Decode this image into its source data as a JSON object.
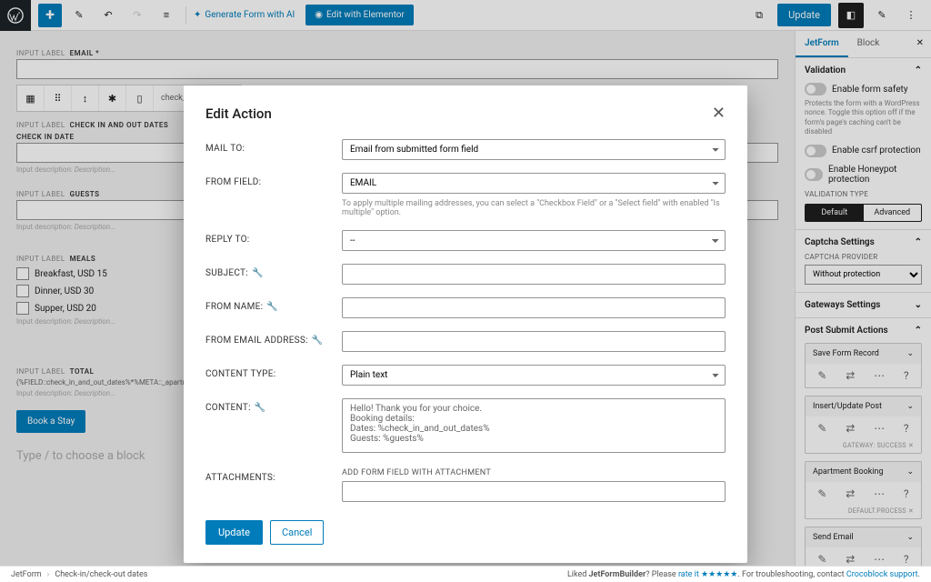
{
  "topbar": {
    "gen_ai": "Generate Form with AI",
    "elementor": "Edit with Elementor",
    "update": "Update"
  },
  "canvas": {
    "email": {
      "prefix": "INPUT LABEL",
      "label": "EMAIL *"
    },
    "toolbar_caption": "check_in_and_out_d",
    "checkin": {
      "prefix": "INPUT LABEL",
      "label": "CHECK IN AND OUT DATES",
      "sublabel": "CHECK IN DATE"
    },
    "desc_prefix": "Input description:",
    "desc_placeholder": "Description...",
    "guests": {
      "prefix": "INPUT LABEL",
      "label": "GUESTS"
    },
    "meals": {
      "prefix": "INPUT LABEL",
      "label": "MEALS",
      "options": [
        "Breakfast, USD 15",
        "Dinner, USD 30",
        "Supper, USD 20"
      ]
    },
    "total": {
      "prefix": "INPUT LABEL",
      "label": "TOTAL",
      "formula": "(%FIELD::check_in_and_out_dates%*%META::_apartment_pr"
    },
    "submit": "Book a Stay",
    "placeholder": "Type / to choose a block"
  },
  "sidebar": {
    "tabs": {
      "jetform": "JetForm",
      "block": "Block"
    },
    "validation": {
      "title": "Validation",
      "safety": "Enable form safety",
      "safety_desc": "Protects the form with a WordPress nonce. Toggle this option off if the form's page's caching can't be disabled",
      "csrf": "Enable csrf protection",
      "honeypot": "Enable Honeypot protection",
      "type_label": "VALIDATION TYPE",
      "default": "Default",
      "advanced": "Advanced"
    },
    "captcha": {
      "title": "Captcha Settings",
      "provider_label": "CAPTCHA PROVIDER",
      "provider_value": "Without protection"
    },
    "gateways": {
      "title": "Gateways Settings"
    },
    "post_submit": {
      "title": "Post Submit Actions",
      "actions": [
        {
          "name": "Save Form Record",
          "meta": ""
        },
        {
          "name": "Insert/Update Post",
          "meta": "GATEWAY: SUCCESS ✕"
        },
        {
          "name": "Apartment Booking",
          "meta": "DEFAULT.PROCESS ✕"
        },
        {
          "name": "Send Email",
          "meta": ""
        }
      ]
    }
  },
  "modal": {
    "title": "Edit Action",
    "rows": {
      "mail_to": {
        "label": "MAIL TO:",
        "value": "Email from submitted form field"
      },
      "from_field": {
        "label": "FROM FIELD:",
        "value": "EMAIL"
      },
      "hint": "To apply multiple mailing addresses, you can select a \"Checkbox Field\" or a \"Select field\" with enabled \"Is multiple\" option.",
      "reply_to": {
        "label": "REPLY TO:",
        "value": "--"
      },
      "subject": {
        "label": "SUBJECT:"
      },
      "from_name": {
        "label": "FROM NAME:"
      },
      "from_email": {
        "label": "FROM EMAIL ADDRESS:"
      },
      "content_type": {
        "label": "CONTENT TYPE:",
        "value": "Plain text"
      },
      "content": {
        "label": "CONTENT:",
        "value": "Hello! Thank you for your choice.\nBooking details:\nDates: %check_in_and_out_dates%\nGuests: %guests%"
      },
      "attachments": {
        "label": "ATTACHMENTS:",
        "sublabel": "ADD FORM FIELD WITH ATTACHMENT"
      }
    },
    "update": "Update",
    "cancel": "Cancel"
  },
  "statusbar": {
    "crumb1": "JetForm",
    "crumb2": "Check-in/check-out dates",
    "right_pre": "Liked ",
    "right_bold": "JetFormBuilder",
    "right_q": "? Please ",
    "rate": "rate it ★★★★★",
    "right_mid": ". For troubleshooting, contact ",
    "support": "Crocoblock support"
  }
}
